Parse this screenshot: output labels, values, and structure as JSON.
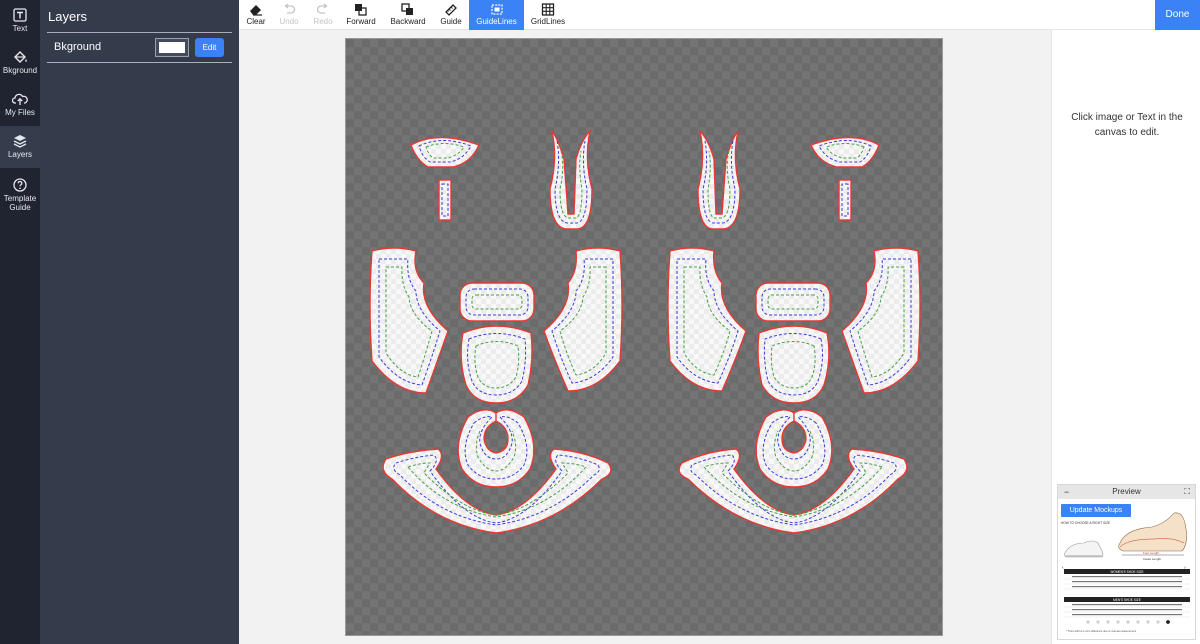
{
  "rail": {
    "items": [
      {
        "label": "Text",
        "icon": "text-icon"
      },
      {
        "label": "Bkground",
        "icon": "paint-bucket-icon"
      },
      {
        "label": "My Files",
        "icon": "cloud-upload-icon"
      },
      {
        "label": "Layers",
        "icon": "layers-icon"
      },
      {
        "label": "Template Guide",
        "icon": "help-circle-icon"
      }
    ],
    "active": "Layers"
  },
  "layers": {
    "title": "Layers",
    "rows": [
      {
        "name": "Bkground",
        "swatch_color": "#ffffff",
        "edit_label": "Edit"
      }
    ]
  },
  "toolbar": {
    "tools": [
      {
        "label": "Clear",
        "icon": "eraser-icon",
        "state": "enabled"
      },
      {
        "label": "Undo",
        "icon": "undo-icon",
        "state": "disabled"
      },
      {
        "label": "Redo",
        "icon": "redo-icon",
        "state": "disabled"
      },
      {
        "label": "Forward",
        "icon": "bring-forward-icon",
        "state": "enabled"
      },
      {
        "label": "Backward",
        "icon": "send-backward-icon",
        "state": "enabled"
      },
      {
        "label": "Guide",
        "icon": "ruler-icon",
        "state": "enabled"
      },
      {
        "label": "GuideLines",
        "icon": "guidelines-icon",
        "state": "active"
      },
      {
        "label": "GridLines",
        "icon": "grid-icon",
        "state": "enabled"
      }
    ],
    "done_label": "Done"
  },
  "right_panel": {
    "hint": "Click image or Text in the canvas to edit."
  },
  "preview": {
    "title": "Preview",
    "minimize_symbol": "−",
    "maximize_symbol": "⛶",
    "update_label": "Update Mockups",
    "size_chart": {
      "heading": "HOW TO CHOOSE A RIGHT SIZE",
      "womens_title": "WOMEN'S SHOE SIZE",
      "mens_title": "MEN'S SHOE SIZE",
      "foot_label_1": "Foot Length",
      "foot_label_2": "Insole Length",
      "footnote": "* There will be 1-2cm difference due to manual measurement"
    }
  },
  "colors": {
    "accent": "#3b82f6",
    "rail_bg": "#1f2430",
    "panel_bg": "#343b4b",
    "cut_line": "#e53935",
    "bleed_line": "#3b3bdd",
    "safe_line": "#43a047"
  }
}
